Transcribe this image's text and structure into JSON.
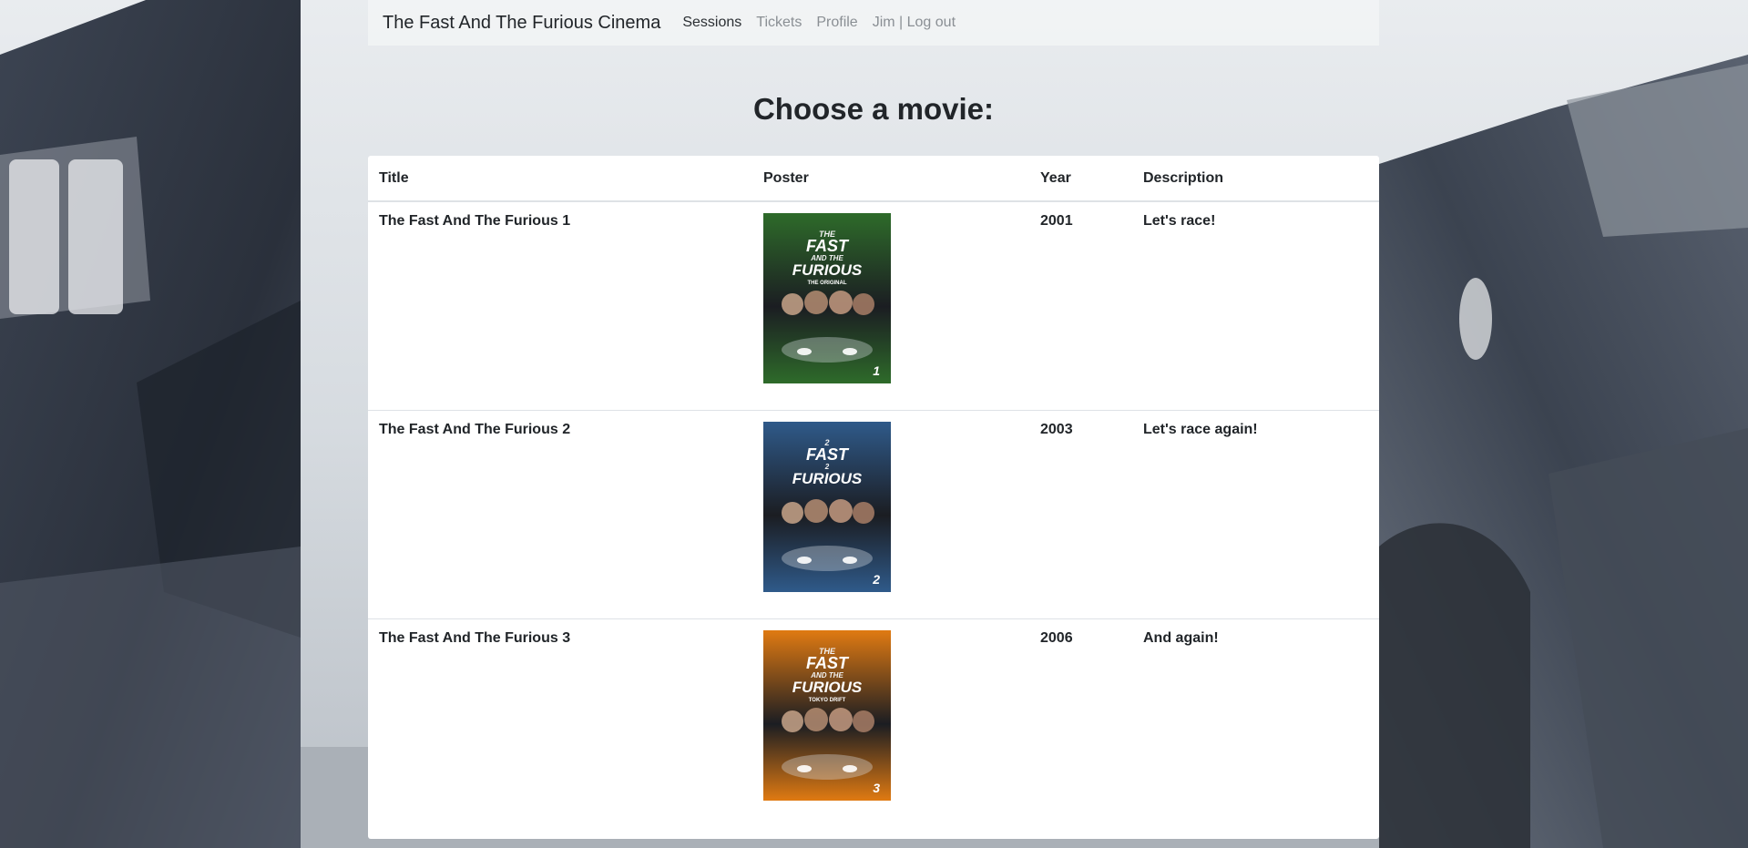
{
  "navbar": {
    "brand": "The Fast And The Furious Cinema",
    "links": [
      {
        "label": "Sessions",
        "active": true
      },
      {
        "label": "Tickets",
        "active": false
      },
      {
        "label": "Profile",
        "active": false
      },
      {
        "label": "Jim | Log out",
        "active": false
      }
    ]
  },
  "page": {
    "title": "Choose a movie:"
  },
  "table": {
    "headers": [
      "Title",
      "Poster",
      "Year",
      "Description"
    ],
    "rows": [
      {
        "title": "The Fast And The Furious 1",
        "year": "2001",
        "description": "Let's race!",
        "poster": {
          "line1": "THE",
          "line2": "FAST",
          "line3": "AND THE",
          "line4": "FURIOUS",
          "sub": "THE ORIGINAL",
          "num": "1",
          "color": "#2e6b2a"
        }
      },
      {
        "title": "The Fast And The Furious 2",
        "year": "2003",
        "description": "Let's race again!",
        "poster": {
          "line1": "2",
          "line2": "FAST",
          "line3": "2",
          "line4": "FURIOUS",
          "sub": "",
          "num": "2",
          "color": "#2f5a8a"
        }
      },
      {
        "title": "The Fast And The Furious 3",
        "year": "2006",
        "description": "And again!",
        "poster": {
          "line1": "THE",
          "line2": "FAST",
          "line3": "AND THE",
          "line4": "FURIOUS",
          "sub": "TOKYO DRIFT",
          "num": "3",
          "color": "#e07a12"
        }
      }
    ]
  }
}
